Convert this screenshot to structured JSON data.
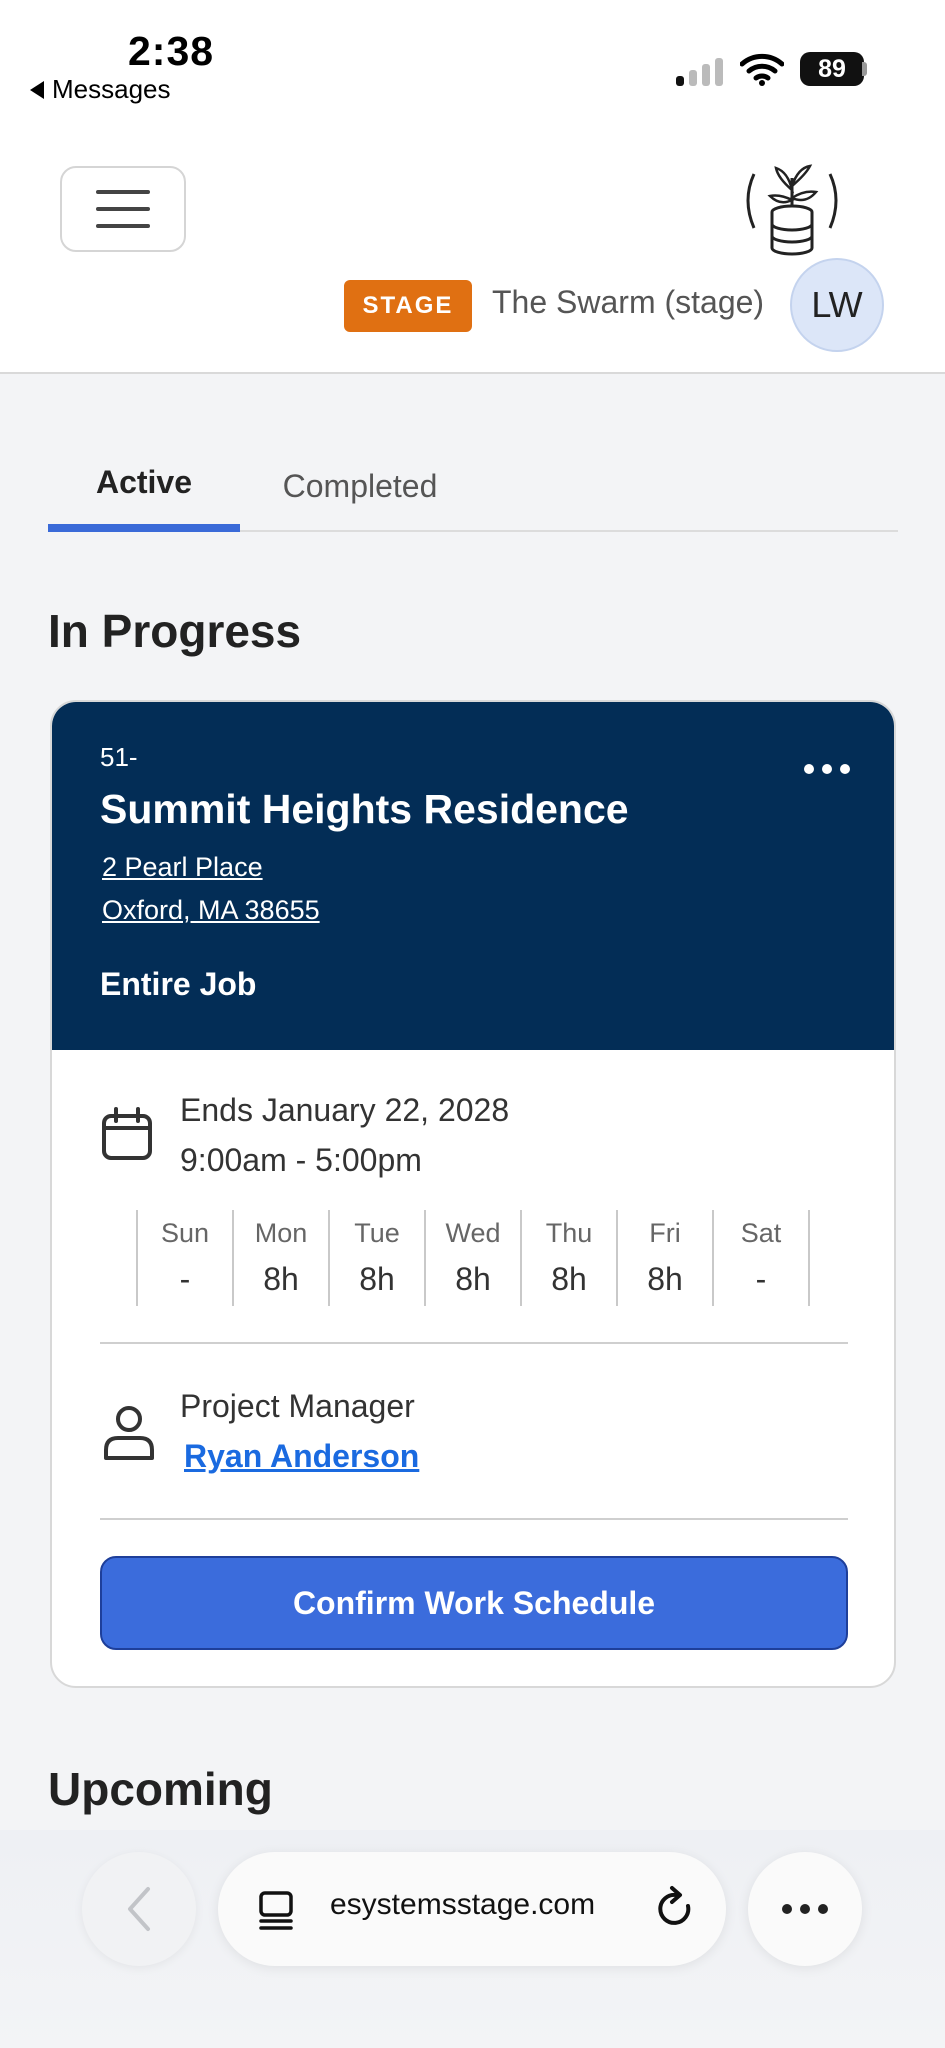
{
  "status_bar": {
    "time": "2:38",
    "back_app": "Messages",
    "battery": "89"
  },
  "header": {
    "stage_badge": "STAGE",
    "org_name": "The Swarm (stage)",
    "avatar_initials": "LW"
  },
  "tabs": [
    {
      "label": "Active",
      "selected": true
    },
    {
      "label": "Completed",
      "selected": false
    }
  ],
  "sections": {
    "in_progress": "In Progress",
    "upcoming": "Upcoming"
  },
  "job_card": {
    "job_number": "51-",
    "title": "Summit Heights Residence",
    "address_line1": "2 Pearl Place",
    "address_line2": "Oxford, MA 38655",
    "scope": "Entire Job",
    "ends": "Ends January 22, 2028",
    "hours": "9:00am - 5:00pm",
    "week": [
      {
        "day": "Sun",
        "hours": "-"
      },
      {
        "day": "Mon",
        "hours": "8h"
      },
      {
        "day": "Tue",
        "hours": "8h"
      },
      {
        "day": "Wed",
        "hours": "8h"
      },
      {
        "day": "Thu",
        "hours": "8h"
      },
      {
        "day": "Fri",
        "hours": "8h"
      },
      {
        "day": "Sat",
        "hours": "-"
      }
    ],
    "pm_label": "Project Manager",
    "pm_name": "Ryan Anderson",
    "confirm_label": "Confirm Work Schedule"
  },
  "browser": {
    "url": "esystemsstage.com"
  },
  "colors": {
    "card_header": "#032d56",
    "accent": "#3b6cdc",
    "stage_badge": "#e07012",
    "link": "#1a6ae0"
  }
}
